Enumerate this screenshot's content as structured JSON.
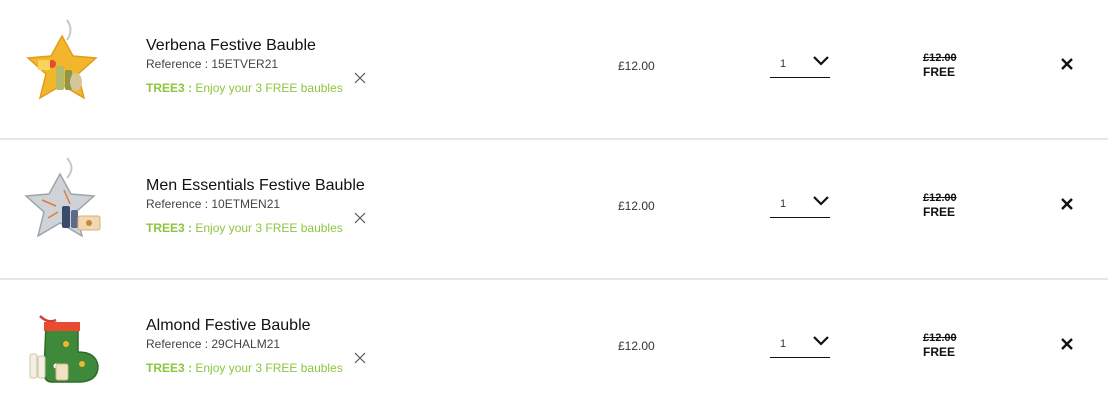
{
  "cart": {
    "items": [
      {
        "image": "verbena-star-bauble-image",
        "name": "Verbena Festive Bauble",
        "reference": "Reference : 15ETVER21",
        "promo_code": "TREE3 :",
        "promo_text": "Enjoy your 3 FREE baubles",
        "unit_price": "£12.00",
        "quantity": "1",
        "original_total": "£12.00",
        "final_total": "FREE"
      },
      {
        "image": "men-essentials-star-bauble-image",
        "name": "Men Essentials Festive Bauble",
        "reference": "Reference : 10ETMEN21",
        "promo_code": "TREE3 :",
        "promo_text": "Enjoy your 3 FREE baubles",
        "unit_price": "£12.00",
        "quantity": "1",
        "original_total": "£12.00",
        "final_total": "FREE"
      },
      {
        "image": "almond-stocking-bauble-image",
        "name": "Almond Festive Bauble",
        "reference": "Reference : 29CHALM21",
        "promo_code": "TREE3 :",
        "promo_text": "Enjoy your 3 FREE baubles",
        "unit_price": "£12.00",
        "quantity": "1",
        "original_total": "£12.00",
        "final_total": "FREE"
      }
    ]
  },
  "colors": {
    "promo_green": "#8cc63f",
    "divider": "#e6e6e6",
    "text": "#111111"
  },
  "icons": {
    "promo_remove": "close-icon",
    "quantity_dropdown": "chevron-down-icon",
    "remove_item": "close-icon"
  }
}
